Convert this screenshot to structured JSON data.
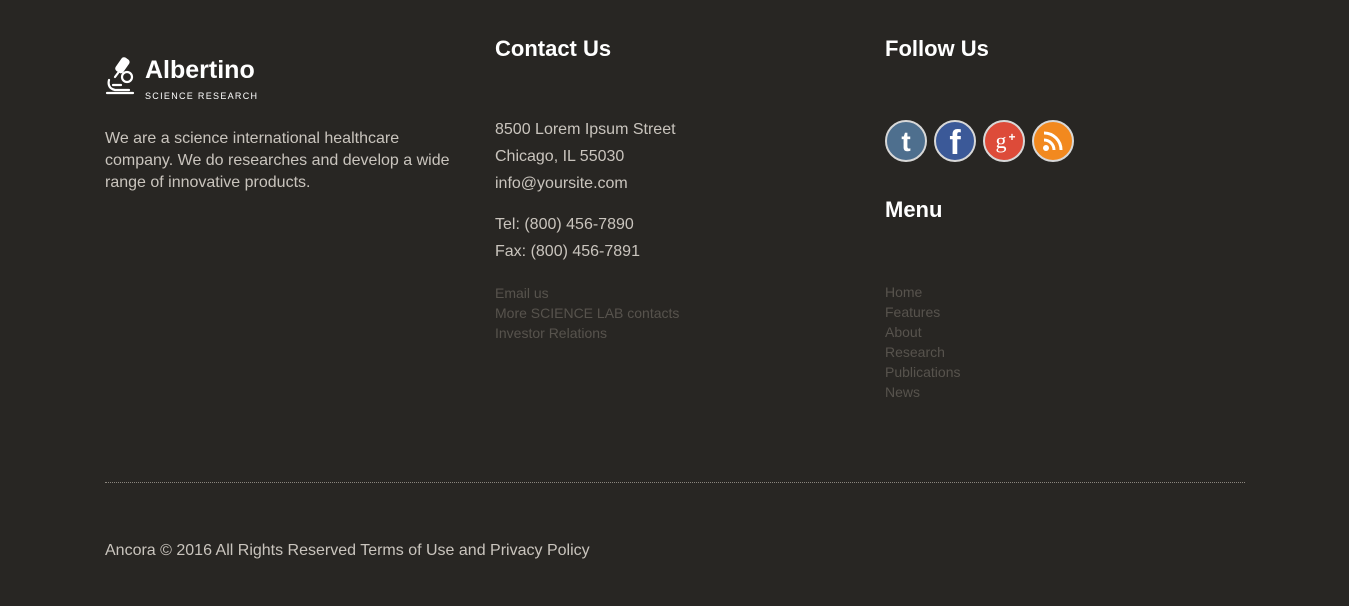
{
  "about": {
    "brand_name": "Albertino",
    "brand_tagline": "SCIENCE RESEARCH",
    "logo_icon": "microscope-icon",
    "description": "We are a science international healthcare company. We do researches and develop a wide range of innovative products."
  },
  "contact": {
    "heading": "Contact Us",
    "address_line1": "8500 Lorem Ipsum Street",
    "address_line2": "Chicago, IL 55030",
    "email": "info@yoursite.com",
    "tel": "Tel: (800) 456-7890",
    "fax": "Fax: (800) 456-7891",
    "links": [
      "Email us",
      "More SCIENCE LAB contacts",
      "Investor Relations"
    ]
  },
  "follow": {
    "heading": "Follow Us",
    "social": [
      {
        "name": "tumblr-icon",
        "color": "#4e6f8e"
      },
      {
        "name": "facebook-icon",
        "color": "#3b5998"
      },
      {
        "name": "google-plus-icon",
        "color": "#dd4b39"
      },
      {
        "name": "rss-icon",
        "color": "#f2891f"
      }
    ]
  },
  "menu": {
    "heading": "Menu",
    "items": [
      "Home",
      "Features",
      "About",
      "Research",
      "Publications",
      "News"
    ]
  },
  "footer": {
    "copyright_prefix": "Ancora © 2016 All Rights Reserved",
    "terms": "Terms of Use",
    "and": "and",
    "privacy": "Privacy Policy"
  },
  "colors": {
    "background": "#282623",
    "text": "#c9c4bd",
    "heading": "#ffffff",
    "muted_link": "#57534d"
  }
}
